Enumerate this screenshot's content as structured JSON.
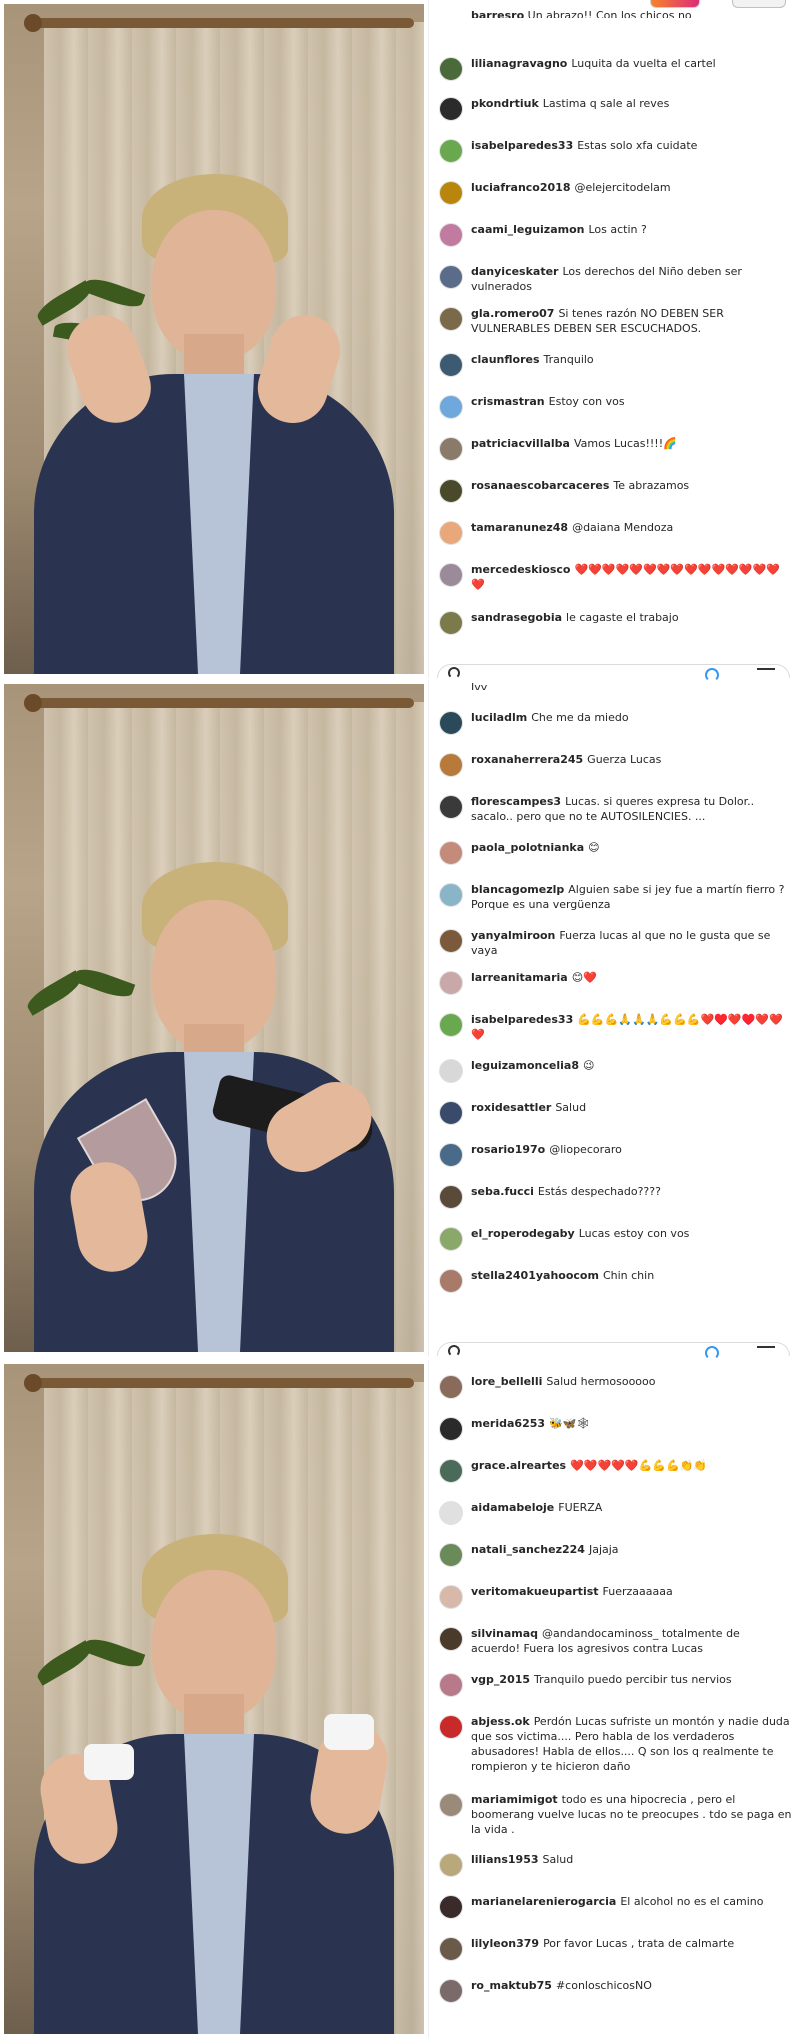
{
  "panels": [
    {
      "id": "panel-1",
      "partial_top": {
        "user": "barresro",
        "text": "Un abrazo!! Con los chicos no"
      },
      "comments": [
        {
          "user": "lilianagravagno",
          "text": "Luquita da vuelta el cartel",
          "avatar_color": "#4a6a3a"
        },
        {
          "user": "pkondrtiuk",
          "text": "Lastima q sale al reves",
          "avatar_color": "#2b2b2b"
        },
        {
          "user": "isabelparedes33",
          "text": "Estas solo xfa cuidate",
          "avatar_color": "#6aa84f"
        },
        {
          "user": "luciafranco2018",
          "text": "@elejercitodelam",
          "avatar_color": "#b8860b"
        },
        {
          "user": "caami_leguizamon",
          "text": "Los actin ?",
          "avatar_color": "#c27ba0"
        },
        {
          "user": "danyiceskater",
          "text": "Los derechos del Niño deben ser vulnerados",
          "avatar_color": "#5b6c8a"
        },
        {
          "user": "gla.romero07",
          "text": "Si tenes razón NO DEBEN SER VULNERABLES DEBEN SER ESCUCHADOS.",
          "avatar_color": "#7a6a4a"
        },
        {
          "user": "claunflores",
          "text": "Tranquilo",
          "avatar_color": "#3d5a73"
        },
        {
          "user": "crismastran",
          "text": "Estoy con vos",
          "avatar_color": "#6fa8dc"
        },
        {
          "user": "patriciacvillalba",
          "text": "Vamos Lucas!!!!🌈",
          "avatar_color": "#8a7a6a"
        },
        {
          "user": "rosanaescobarcaceres",
          "text": "Te abrazamos",
          "avatar_color": "#4a4a2a"
        },
        {
          "user": "tamaranunez48",
          "text": "@daiana Mendoza",
          "avatar_color": "#e8a87c"
        },
        {
          "user": "mercedeskiosco",
          "text": "❤️❤️❤️❤️❤️❤️❤️❤️❤️❤️❤️❤️❤️❤️❤️❤️",
          "avatar_color": "#9a8a9a"
        },
        {
          "user": "sandrasegobia",
          "text": "le cagaste el trabajo",
          "avatar_color": "#7a7a4a"
        }
      ]
    },
    {
      "id": "panel-2",
      "partial_top": {
        "user": "",
        "text": "Jyy"
      },
      "comments": [
        {
          "user": "luciladlm",
          "text": "Che me da miedo",
          "avatar_color": "#2a4a5a"
        },
        {
          "user": "roxanaherrera245",
          "text": "Guerza Lucas",
          "avatar_color": "#b87a3a"
        },
        {
          "user": "florescampes3",
          "text": "Lucas. si queres expresa tu Dolor.. sacalo.. pero que no te AUTOSILENCIES. ...",
          "avatar_color": "#3a3a3a"
        },
        {
          "user": "paola_polotnianka",
          "text": "😊",
          "avatar_color": "#c48a7a"
        },
        {
          "user": "blancagomezlp",
          "text": "Alguien sabe si jey fue a martín fierro ? Porque es una vergüenza",
          "avatar_color": "#8ab4c8"
        },
        {
          "user": "yanyalmiroon",
          "text": "Fuerza lucas al que no le gusta que se vaya",
          "avatar_color": "#7a5a3a"
        },
        {
          "user": "larreanitamaria",
          "text": "😊❤️",
          "avatar_color": "#c8a8a8"
        },
        {
          "user": "isabelparedes33",
          "text": "💪💪💪🙏🙏🙏💪💪💪❤️♥️❤️♥️❤️❤️❤️",
          "avatar_color": "#6aa84f"
        },
        {
          "user": "leguizamoncelia8",
          "text": "😉",
          "avatar_color": "#d8d8d8"
        },
        {
          "user": "roxidesattler",
          "text": "Salud",
          "avatar_color": "#3a4a6a"
        },
        {
          "user": "rosario197o",
          "text": "@liopecoraro",
          "avatar_color": "#4a6a8a"
        },
        {
          "user": "seba.fucci",
          "text": "Estás despechado????",
          "avatar_color": "#5a4a3a"
        },
        {
          "user": "el_roperodegaby",
          "text": "Lucas estoy con vos",
          "avatar_color": "#8aa86a"
        },
        {
          "user": "stella2401yahoocom",
          "text": "Chin chin",
          "avatar_color": "#a87a6a"
        }
      ]
    },
    {
      "id": "panel-3",
      "partial_top": {
        "user": "",
        "text": ""
      },
      "comments": [
        {
          "user": "lore_bellelli",
          "text": "Salud hermosooooo",
          "avatar_color": "#8a6a5a"
        },
        {
          "user": "merida6253",
          "text": "🐝🦋🕸",
          "avatar_color": "#2a2a2a"
        },
        {
          "user": "grace.alreartes",
          "text": "❤️❤️❤️❤️❤️💪💪💪👏👏",
          "avatar_color": "#4a6a5a"
        },
        {
          "user": "aidamabeloje",
          "text": "FUERZA",
          "avatar_color": "#e0e0e0"
        },
        {
          "user": "natali_sanchez224",
          "text": "Jajaja",
          "avatar_color": "#6a8a5a"
        },
        {
          "user": "veritomakueupartist",
          "text": "Fuerzaaaaaa",
          "avatar_color": "#d8b8a8"
        },
        {
          "user": "silvinamaq",
          "text": "@andandocaminoss_ totalmente de acuerdo! Fuera los agresivos contra Lucas",
          "avatar_color": "#4a3a2a"
        },
        {
          "user": "vgp_2015",
          "text": "Tranquilo puedo percibir tus nervios",
          "avatar_color": "#b87a8a"
        },
        {
          "user": "abjess.ok",
          "text": "Perdón Lucas sufriste un montón y nadie duda que sos victima.... Pero habla de los verdaderos abusadores! Habla de ellos.... Q son los q realmente te rompieron y te hicieron daño",
          "avatar_color": "#c82a2a"
        },
        {
          "user": "mariamimigot",
          "text": "todo es una hipocrecia , pero el boomerang vuelve lucas no te preocupes . tdo se paga en la vida .",
          "avatar_color": "#9a8a7a"
        },
        {
          "user": "lilians1953",
          "text": "Salud",
          "avatar_color": "#b8a87a"
        },
        {
          "user": "marianelarenierogarcia",
          "text": "El alcohol no es el camino",
          "avatar_color": "#3a2a2a"
        },
        {
          "user": "lilyleon379",
          "text": "Por favor Lucas , trata de calmarte",
          "avatar_color": "#6a5a4a"
        },
        {
          "user": "ro_maktub75",
          "text": "#conloschicosNO",
          "avatar_color": "#7a6a6a"
        }
      ]
    }
  ]
}
